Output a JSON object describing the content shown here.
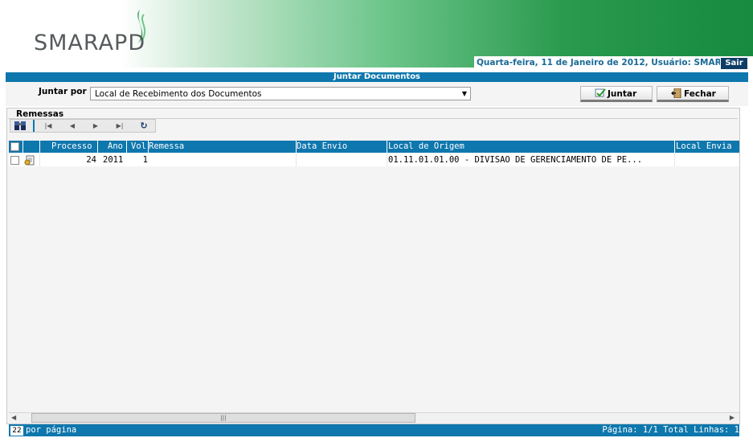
{
  "header": {
    "logo_text": "SMARAPD",
    "status_text": "Quarta-feira, 11 de Janeiro de 2012, Usuário: SMAR",
    "logout_label": "Sair"
  },
  "page_title": "Juntar Documentos",
  "form": {
    "join_by_label": "Juntar por",
    "join_by_value": "Local de Recebimento dos Documentos",
    "join_button": "Juntar",
    "close_button": "Fechar"
  },
  "panel": {
    "title": "Remessas"
  },
  "grid": {
    "columns": [
      "Processo",
      "Ano",
      "Vol",
      "Remessa",
      "Data Envio",
      "Local de Origem",
      "Local Envia"
    ],
    "rows": [
      {
        "processo": "24",
        "ano": "2011",
        "vol": "1",
        "remessa": "",
        "data_envio": "",
        "local_origem": "01.11.01.01.00 - DIVISAO DE GERENCIAMENTO DE PE...",
        "local_envia": ""
      }
    ]
  },
  "footer": {
    "per_page_value": "22",
    "per_page_label": "por página",
    "pagination_text": "Página: 1/1 Total Linhas: 1"
  },
  "colors": {
    "accent_blue": "#0e77ad",
    "status_text": "#1a6a96",
    "header_green": "#178a3f"
  }
}
